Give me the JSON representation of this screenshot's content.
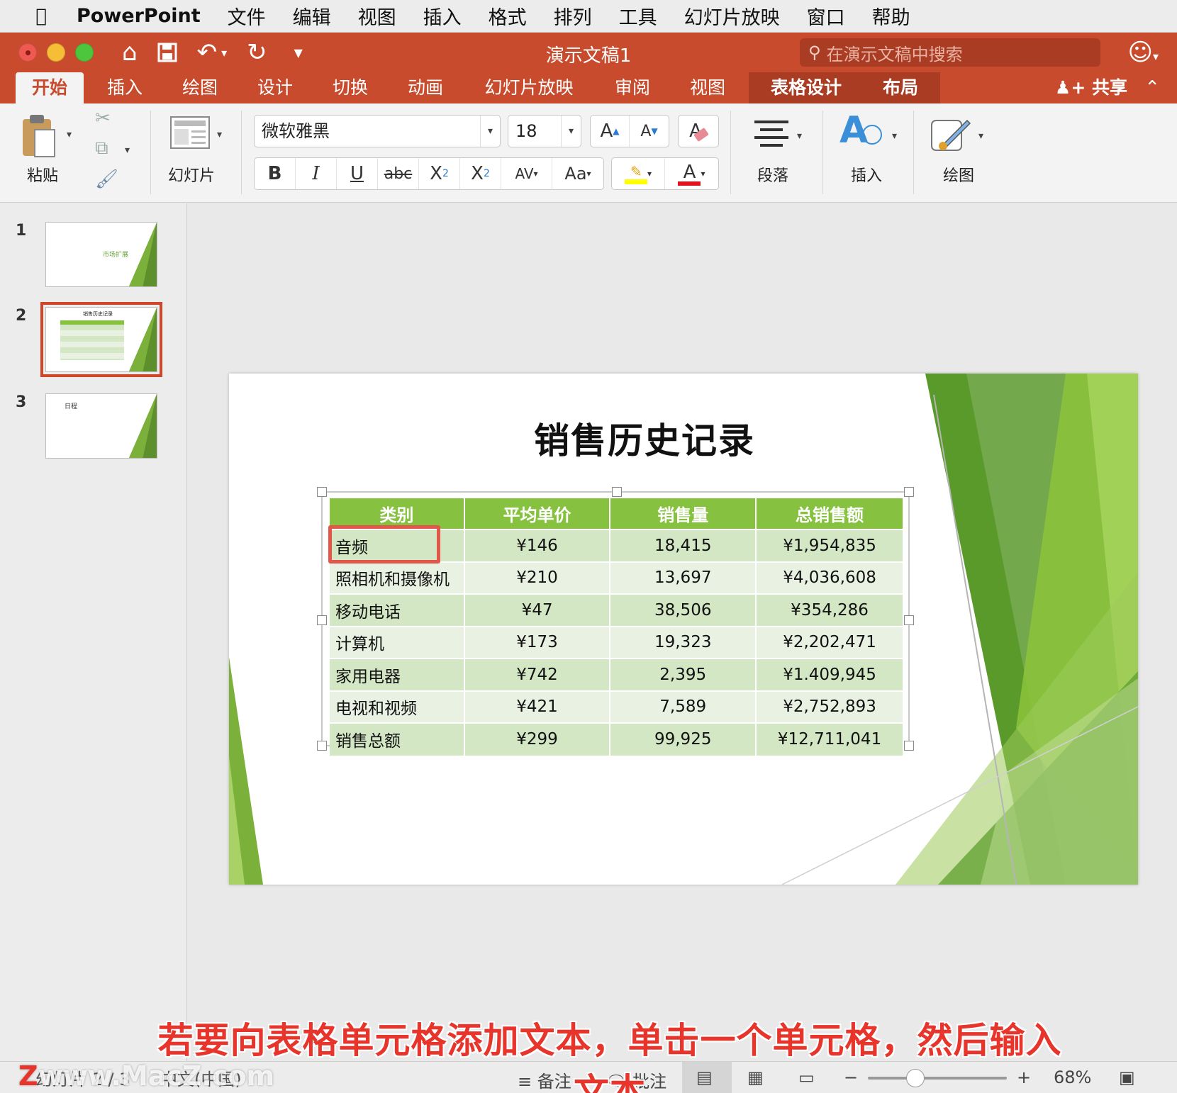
{
  "menubar": {
    "app_name": "PowerPoint",
    "items": [
      "文件",
      "编辑",
      "视图",
      "插入",
      "格式",
      "排列",
      "工具",
      "幻灯片放映",
      "窗口",
      "帮助"
    ]
  },
  "window": {
    "title": "演示文稿1",
    "search_placeholder": "在演示文稿中搜索"
  },
  "tabs": [
    {
      "label": "开始",
      "active": true
    },
    {
      "label": "插入"
    },
    {
      "label": "绘图"
    },
    {
      "label": "设计"
    },
    {
      "label": "切换"
    },
    {
      "label": "动画"
    },
    {
      "label": "幻灯片放映"
    },
    {
      "label": "审阅"
    },
    {
      "label": "视图"
    },
    {
      "label": "表格设计",
      "contextual": true
    },
    {
      "label": "布局",
      "contextual": true
    }
  ],
  "share_label": "共享",
  "ribbon": {
    "paste_label": "粘贴",
    "slides_label": "幻灯片",
    "font_name": "微软雅黑",
    "font_size": "18",
    "paragraph_label": "段落",
    "insert_label": "插入",
    "draw_label": "绘图"
  },
  "thumbnails": [
    {
      "number": "1",
      "text": "市场扩展"
    },
    {
      "number": "2",
      "text": "销售历史记录",
      "selected": true
    },
    {
      "number": "3",
      "text": "日程"
    }
  ],
  "slide": {
    "title": "销售历史记录",
    "table": {
      "headers": [
        "类别",
        "平均单价",
        "销售量",
        "总销售额"
      ],
      "rows": [
        [
          "音频",
          "¥146",
          "18,415",
          "¥1,954,835"
        ],
        [
          "照相机和摄像机",
          "¥210",
          "13,697",
          "¥4,036,608"
        ],
        [
          "移动电话",
          "¥47",
          "38,506",
          "¥354,286"
        ],
        [
          "计算机",
          "¥173",
          "19,323",
          "¥2,202,471"
        ],
        [
          "家用电器",
          "¥742",
          "2,395",
          "¥1.409,945"
        ],
        [
          "电视和视频",
          "¥421",
          "7,589",
          "¥2,752,893"
        ],
        [
          "销售总额",
          "¥299",
          "99,925",
          "¥12,711,041"
        ]
      ]
    }
  },
  "statusbar": {
    "slide_indicator": "幻灯片 2 / 3",
    "language": "中文(中国)",
    "notes_label": "备注",
    "comments_label": "批注",
    "zoom": "68%"
  },
  "caption": "若要向表格单元格添加文本，单击一个单元格，然后输入文本",
  "watermark": "www.MacZ.com",
  "colors": {
    "ribbon_red": "#c84b2d",
    "table_header": "#86c240",
    "slide_green": "#7bb03a"
  }
}
